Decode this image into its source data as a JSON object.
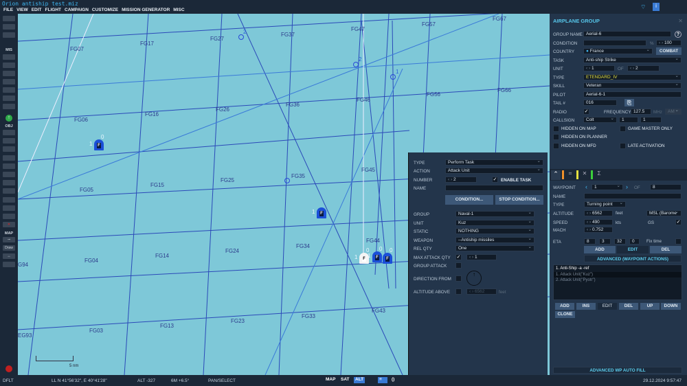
{
  "window": {
    "title": "Orion antiship test.miz"
  },
  "menu": [
    "FILE",
    "VIEW",
    "EDIT",
    "FLIGHT",
    "CAMPAIGN",
    "CUSTOMIZE",
    "MISSION GENERATOR",
    "MISC"
  ],
  "toolbar": {
    "mis": "MIS",
    "obj": "OBJ",
    "map": "MAP",
    "draw": "Draw"
  },
  "map": {
    "grid_labels": [
      "FG07",
      "FG17",
      "FG27",
      "FG37",
      "FG47",
      "FG57",
      "FG67",
      "FG06",
      "FG16",
      "FG26",
      "FG36",
      "FG46",
      "FG56",
      "FG66",
      "FG05",
      "FG15",
      "FG25",
      "FG35",
      "FG45",
      "FG04",
      "FG14",
      "FG24",
      "FG34",
      "FG44",
      "FG03",
      "FG13",
      "FG23",
      "FG33",
      "FG43",
      "G94",
      "EG93"
    ],
    "waypoint_numbers": [
      "2",
      "2",
      "1"
    ],
    "units": [
      {
        "label": "F",
        "count": "1",
        "sub": "0",
        "color": "blue"
      },
      {
        "label": "F",
        "count": "1",
        "sub": "",
        "color": "blue"
      },
      {
        "label": "F",
        "count": "1",
        "sub": "0",
        "color": "white"
      },
      {
        "label": "F",
        "count": "1",
        "sub": "0",
        "color": "blue"
      },
      {
        "label": "F",
        "count": "",
        "sub": "0",
        "color": "blue"
      }
    ],
    "scale": "5 nm"
  },
  "task": {
    "type_label": "TYPE",
    "type": "Perform Task",
    "action_label": "ACTION",
    "action": "Attack Unit",
    "number_label": "NUMBER",
    "number": "2",
    "enable_label": "ENABLE TASK",
    "name_label": "NAME",
    "name": "",
    "condition": "CONDITION...",
    "stop_condition": "STOP CONDITION...",
    "group_label": "GROUP",
    "group": "Naval-1",
    "unit_label": "UNIT",
    "unit": "Kuz",
    "static_label": "STATIC",
    "static": "NOTHING",
    "weapon_label": "WEAPON",
    "weapon": "--Antiship missiles",
    "relqty_label": "REL QTY",
    "relqty": "One",
    "maxqty_label": "MAX ATTACK QTY",
    "maxqty": "1",
    "groupattack_label": "GROUP ATTACK",
    "direction_label": "DIRECTION FROM",
    "altitude_label": "ALTITUDE ABOVE",
    "altitude": "6562",
    "altitude_unit": "feet"
  },
  "group": {
    "header": "AIRPLANE GROUP",
    "name_label": "GROUP NAME",
    "name": "Aerial-6",
    "condition_label": "CONDITION",
    "condition": "",
    "percent": "%",
    "prob": "100",
    "country_label": "COUNTRY",
    "country": "France",
    "combat": "COMBAT",
    "task_label": "TASK",
    "task": "Anti-ship Strike",
    "unit_label": "UNIT",
    "unit": "1",
    "of": "OF",
    "unit_total": "2",
    "type_label": "TYPE",
    "type": "ETENDARD_IV",
    "skill_label": "SKILL",
    "skill": "Veteran",
    "pilot_label": "PILOT",
    "pilot": "Aerial-6-1",
    "tail_label": "TAIL #",
    "tail": "016",
    "radio_label": "RADIO",
    "freq_label": "FREQUENCY",
    "freq": "127.5",
    "mhz": "MHz",
    "mod": "AM",
    "callsign_label": "CALLSIGN",
    "callsign": "Colt",
    "cs1": "1",
    "cs2": "1",
    "hidden_map": "HIDDEN ON MAP",
    "gm_only": "GAME MASTER ONLY",
    "hidden_planner": "HIDDEN ON PLANNER",
    "hidden_mfd": "HIDDEN ON MFD",
    "late": "LATE ACTIVATION"
  },
  "waypoint": {
    "wp_label": "WAYPOINT",
    "wp": "1",
    "of": "OF",
    "total": "8",
    "name_label": "NAME",
    "name": "",
    "type_label": "TYPE",
    "type": "Turning point",
    "alt_label": "ALTITUDE",
    "alt": "6562",
    "alt_unit": "feet",
    "alt_ref": "MSL (Barome",
    "speed_label": "SPEED",
    "speed": "490",
    "speed_unit": "kts",
    "gs": "GS",
    "mach_label": "MACH",
    "mach": "0.752",
    "eta_label": "ETA",
    "eta_d": "8",
    "eta_h": "3",
    "eta_m": "32",
    "eta_s": "0",
    "fix": "Fix time",
    "add": "ADD",
    "edit": "EDIT",
    "del": "DEL",
    "advanced": "ADVANCED (WAYPOINT ACTIONS)",
    "actions": [
      "1. Anti-Ship -a -ref",
      "1. Attack Unit(\"Kuz\")",
      "2. Attack Unit(\"Pyotr\")"
    ],
    "btns": [
      "ADD",
      "INS",
      "EDIT",
      "DEL",
      "UP",
      "DOWN",
      "CLONE"
    ],
    "autofill": "ADVANCED WP AUTO FILL"
  },
  "status": {
    "mode": "DFLT",
    "ll": "LL  N 41°56'32\", E 40°41'28\"",
    "alt": "ALT  -327",
    "magvar": "6M  +6.5°",
    "pan": "PAN/SELECT",
    "map": "MAP",
    "sat": "SAT",
    "altbtn": "ALT",
    "datetime": "29.12.2024 9:57:47"
  }
}
